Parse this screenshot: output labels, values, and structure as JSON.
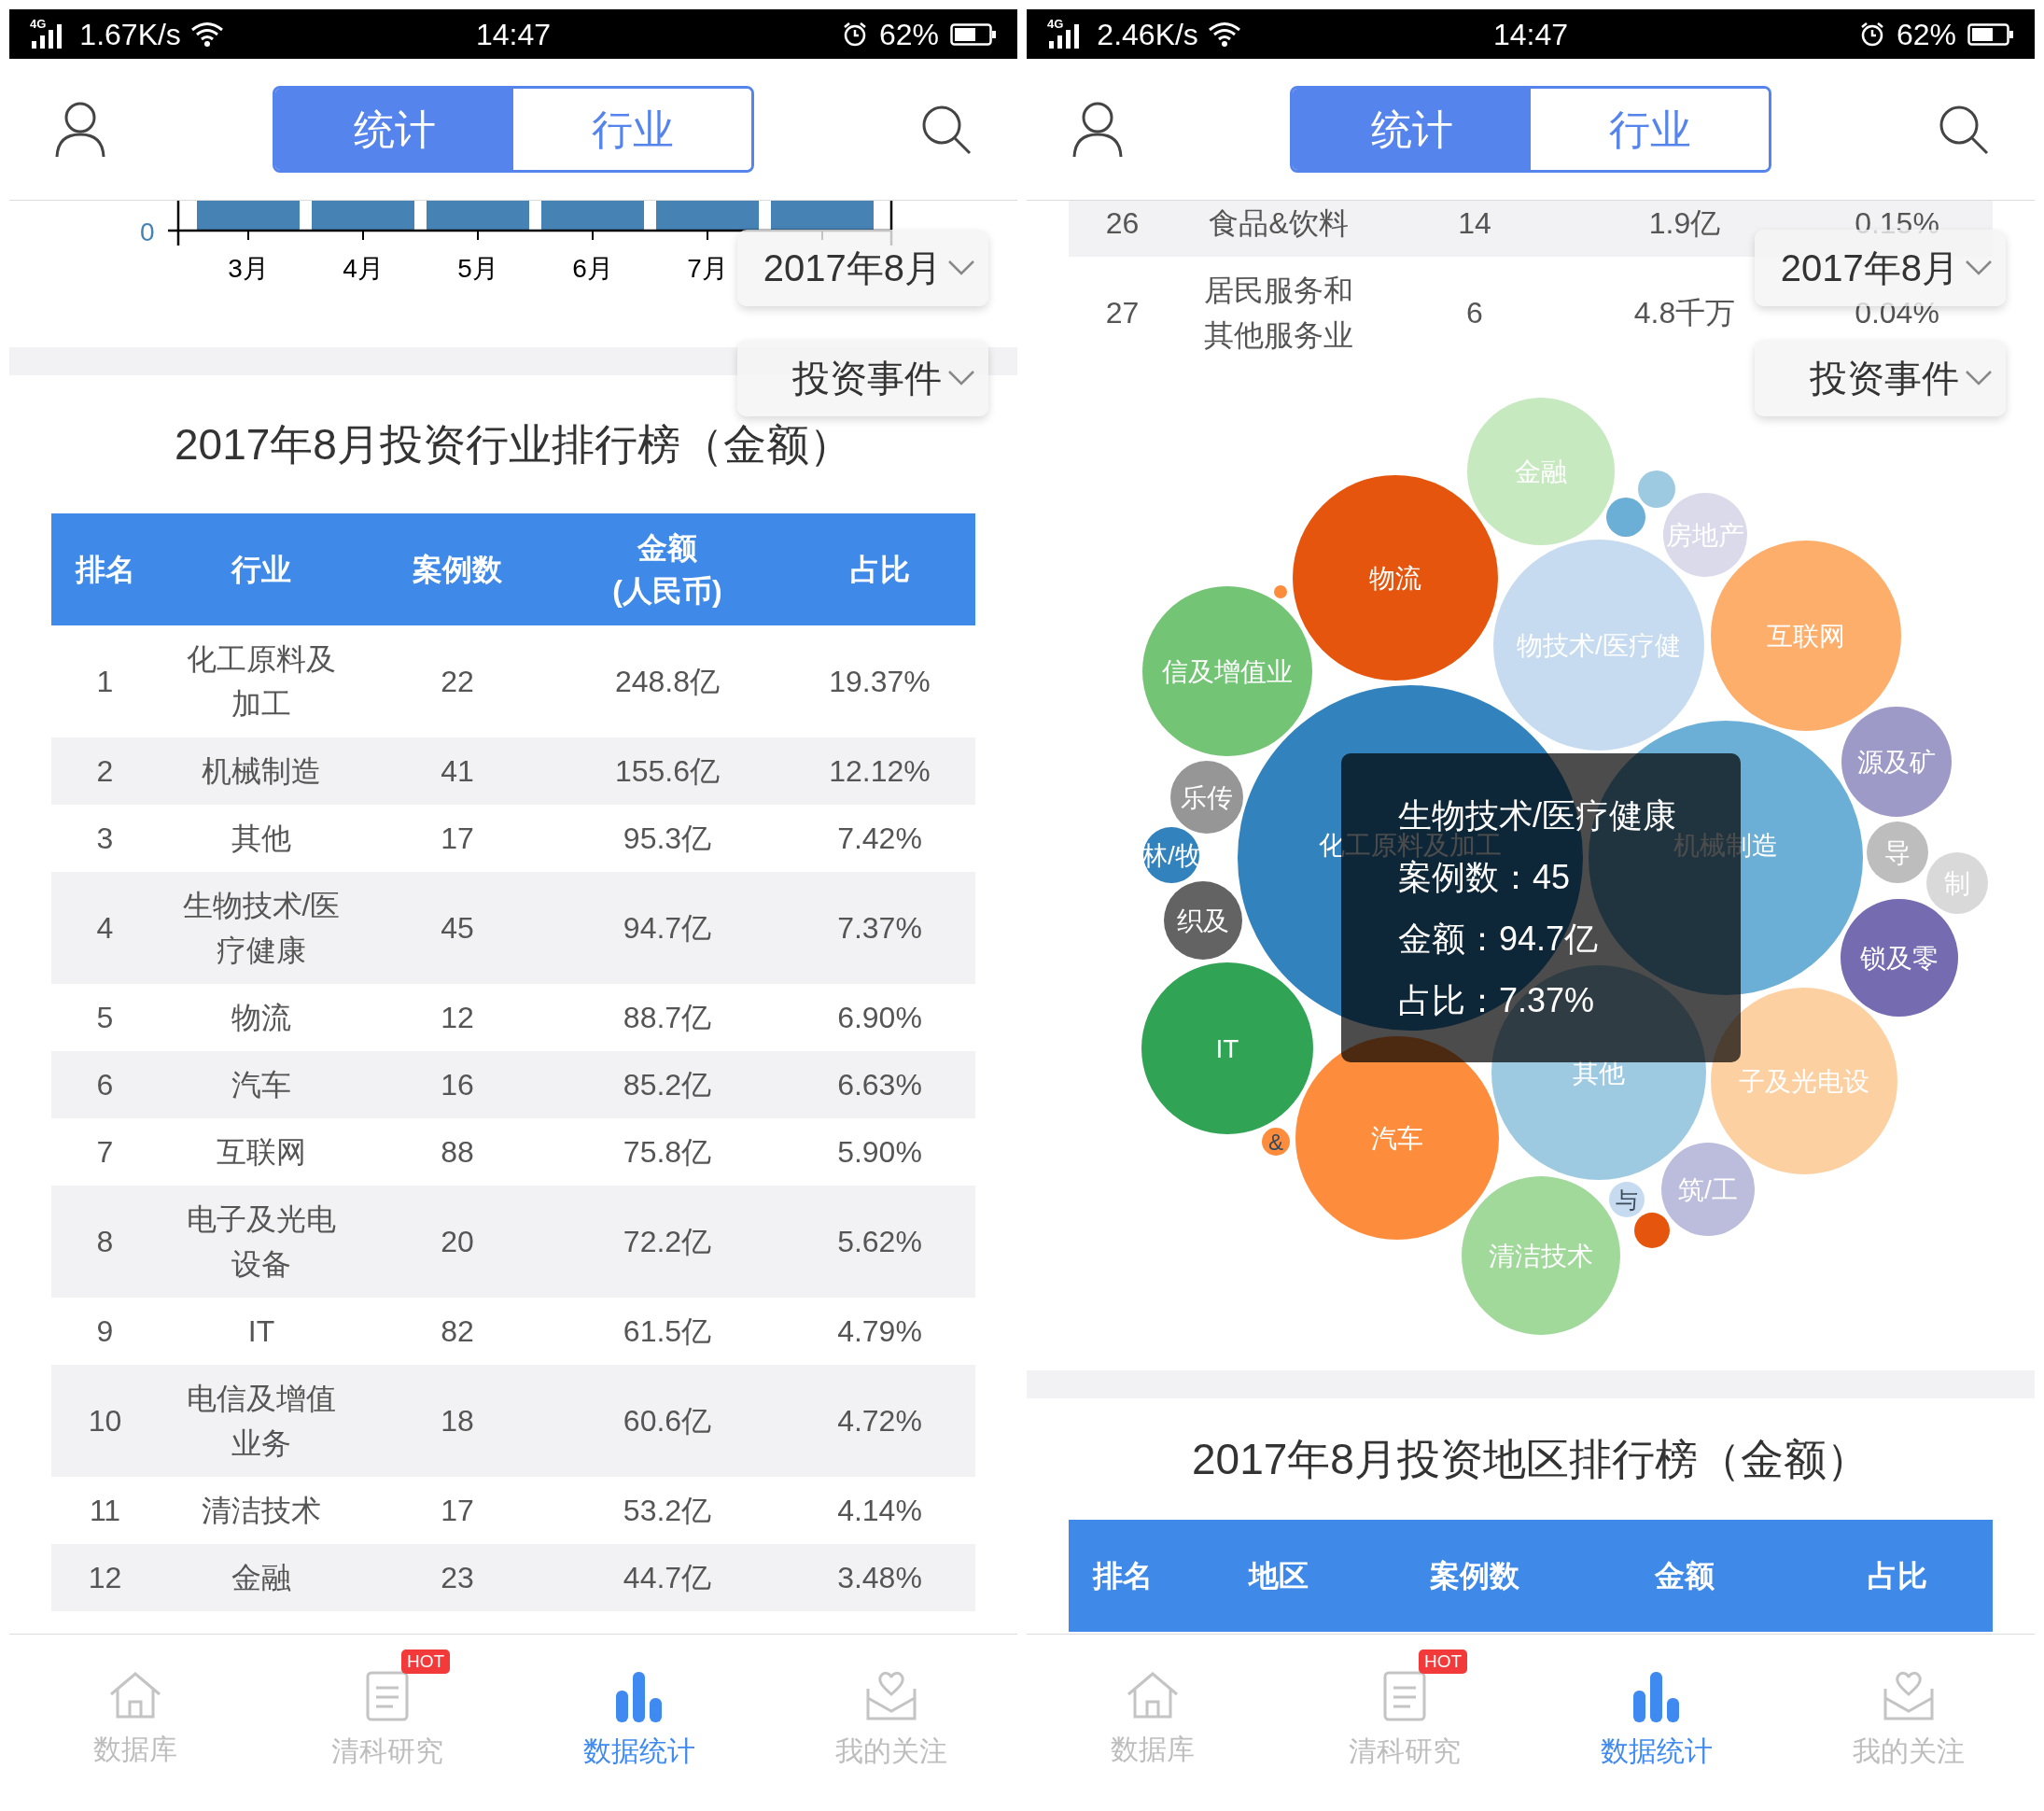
{
  "left_screen": {
    "status_bar": {
      "network": "4G",
      "speed": "1.67K/s",
      "time": "14:47",
      "battery": "62%"
    },
    "tabs": [
      {
        "label": "统计",
        "selected": true
      },
      {
        "label": "行业",
        "selected": false
      }
    ],
    "month_chart": {
      "y_tick": "0",
      "months": [
        "3月",
        "4月",
        "5月",
        "6月",
        "7月"
      ]
    },
    "ranking": {
      "title": "2017年8月投资行业排行榜（金额）",
      "columns": [
        {
          "lines": [
            "排名"
          ]
        },
        {
          "lines": [
            "行业"
          ]
        },
        {
          "lines": [
            "案例数"
          ]
        },
        {
          "lines": [
            "金额",
            "(人民币)"
          ]
        },
        {
          "lines": [
            "占比"
          ]
        }
      ],
      "rows": [
        {
          "shaded": false,
          "cells": [
            "1",
            "化工原料及加工",
            "22",
            "248.8亿",
            "19.37%"
          ]
        },
        {
          "shaded": true,
          "cells": [
            "2",
            "机械制造",
            "41",
            "155.6亿",
            "12.12%"
          ]
        },
        {
          "shaded": false,
          "cells": [
            "3",
            "其他",
            "17",
            "95.3亿",
            "7.42%"
          ]
        },
        {
          "shaded": true,
          "cells": [
            "4",
            "生物技术/医疗健康",
            "45",
            "94.7亿",
            "7.37%"
          ]
        },
        {
          "shaded": false,
          "cells": [
            "5",
            "物流",
            "12",
            "88.7亿",
            "6.90%"
          ]
        },
        {
          "shaded": true,
          "cells": [
            "6",
            "汽车",
            "16",
            "85.2亿",
            "6.63%"
          ]
        },
        {
          "shaded": false,
          "cells": [
            "7",
            "互联网",
            "88",
            "75.8亿",
            "5.90%"
          ]
        },
        {
          "shaded": true,
          "cells": [
            "8",
            "电子及光电设备",
            "20",
            "72.2亿",
            "5.62%"
          ]
        },
        {
          "shaded": false,
          "cells": [
            "9",
            "IT",
            "82",
            "61.5亿",
            "4.79%"
          ]
        },
        {
          "shaded": true,
          "cells": [
            "10",
            "电信及增值业务",
            "18",
            "60.6亿",
            "4.72%"
          ]
        },
        {
          "shaded": false,
          "cells": [
            "11",
            "清洁技术",
            "17",
            "53.2亿",
            "4.14%"
          ]
        },
        {
          "shaded": true,
          "cells": [
            "12",
            "金融",
            "23",
            "44.7亿",
            "3.48%"
          ]
        }
      ]
    },
    "dropdowns": [
      "2017年8月",
      "投资事件"
    ],
    "nav": [
      {
        "label": "数据库",
        "selected": false
      },
      {
        "label": "清科研究",
        "selected": false,
        "badge": "HOT"
      },
      {
        "label": "数据统计",
        "selected": true
      },
      {
        "label": "我的关注",
        "selected": false
      }
    ]
  },
  "right_screen": {
    "status_bar": {
      "network": "4G",
      "speed": "2.46K/s",
      "time": "14:47",
      "battery": "62%"
    },
    "tabs": [
      {
        "label": "统计",
        "selected": true
      },
      {
        "label": "行业",
        "selected": false
      }
    ],
    "industry_rows": [
      {
        "shaded": true,
        "cells": [
          "26",
          "食品&饮料",
          "14",
          "1.9亿",
          "0.15%"
        ]
      },
      {
        "shaded": false,
        "cells": [
          "27",
          "居民服务和其他服务业",
          "6",
          "4.8千万",
          "0.04%"
        ]
      }
    ],
    "bubble_chart": {
      "bubbles": [
        {
          "label": "金融",
          "color": "#c7e9c0"
        },
        {
          "color": "#9ecae1"
        },
        {
          "color": "#6baed6"
        },
        {
          "label": "房地产",
          "color": "#dadaeb"
        },
        {
          "label": "物流",
          "color": "#e6550d"
        },
        {
          "color": "#fd8d3c"
        },
        {
          "label": "互联网",
          "color": "#fdae6b"
        },
        {
          "label": "物技术/医疗健",
          "color": "#c6dbef"
        },
        {
          "label": "信及增值业",
          "color": "#74c476"
        },
        {
          "label": "源及矿",
          "color": "#9e9ac8"
        },
        {
          "label": "乐传",
          "color": "#969696"
        },
        {
          "label": "林/牧",
          "color": "#3182bd"
        },
        {
          "label": "化工原料及加工",
          "color": "#3182bd"
        },
        {
          "label": "机械制造",
          "color": "#6baed6"
        },
        {
          "label": "导",
          "color": "#bdbdbd"
        },
        {
          "label": "制",
          "color": "#d9d9d9"
        },
        {
          "label": "织及",
          "color": "#636363"
        },
        {
          "label": "锁及零",
          "color": "#756bb1"
        },
        {
          "label": "IT",
          "color": "#31a354"
        },
        {
          "label": "其他",
          "color": "#9ecae1"
        },
        {
          "label": "子及光电设",
          "color": "#fdd0a2"
        },
        {
          "label": "汽车",
          "color": "#fd8d3c"
        },
        {
          "label": "&",
          "color": "#fd8d3c"
        },
        {
          "label": "筑/工",
          "color": "#bcbddc"
        },
        {
          "label": "与",
          "color": "#c6dbef"
        },
        {
          "color": "#e6550d"
        },
        {
          "label": "清洁技术",
          "color": "#a1d99b"
        }
      ],
      "tooltip": {
        "title": "生物技术/医疗健康",
        "lines": [
          "案例数：45",
          "金额：94.7亿",
          "占比：7.37%"
        ]
      }
    },
    "region_ranking": {
      "title": "2017年8月投资地区排行榜（金额）",
      "columns": [
        {
          "lines": [
            "排名"
          ]
        },
        {
          "lines": [
            "地区"
          ]
        },
        {
          "lines": [
            "案例数"
          ]
        },
        {
          "lines": [
            "金额"
          ]
        },
        {
          "lines": [
            "占比"
          ]
        }
      ]
    },
    "dropdowns": [
      "2017年8月",
      "投资事件"
    ],
    "nav": [
      {
        "label": "数据库",
        "selected": false
      },
      {
        "label": "清科研究",
        "selected": false,
        "badge": "HOT"
      },
      {
        "label": "数据统计",
        "selected": true
      },
      {
        "label": "我的关注",
        "selected": false
      }
    ]
  }
}
